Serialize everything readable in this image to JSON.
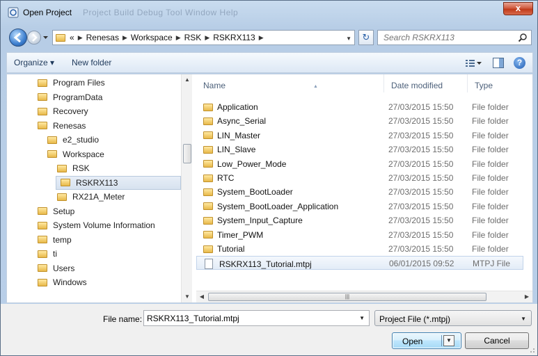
{
  "window": {
    "title": "Open Project",
    "title_ghost": "Project   Build   Debug   Tool   Window   Help",
    "close_label": "x"
  },
  "address": {
    "prefix": "«",
    "crumbs": [
      "Renesas",
      "Workspace",
      "RSK",
      "RSKRX113"
    ],
    "refresh_glyph": "↻"
  },
  "search": {
    "placeholder": "Search RSKRX113"
  },
  "toolbar": {
    "organize": "Organize ▾",
    "new_folder": "New folder",
    "help_glyph": "?"
  },
  "nav_tree": [
    {
      "label": "Program Files",
      "indent": 0
    },
    {
      "label": "ProgramData",
      "indent": 0
    },
    {
      "label": "Recovery",
      "indent": 0
    },
    {
      "label": "Renesas",
      "indent": 0
    },
    {
      "label": "e2_studio",
      "indent": 1
    },
    {
      "label": "Workspace",
      "indent": 1
    },
    {
      "label": "RSK",
      "indent": 2
    },
    {
      "label": "RSKRX113",
      "indent": 3,
      "selected": true
    },
    {
      "label": "RX21A_Meter",
      "indent": 2
    },
    {
      "label": "Setup",
      "indent": 0
    },
    {
      "label": "System Volume Information",
      "indent": 0
    },
    {
      "label": "temp",
      "indent": 0
    },
    {
      "label": "ti",
      "indent": 0
    },
    {
      "label": "Users",
      "indent": 0
    },
    {
      "label": "Windows",
      "indent": 0
    }
  ],
  "columns": {
    "name": "Name",
    "date": "Date modified",
    "type": "Type"
  },
  "files": [
    {
      "name": "Application",
      "date": "27/03/2015 15:50",
      "type": "File folder",
      "kind": "folder"
    },
    {
      "name": "Async_Serial",
      "date": "27/03/2015 15:50",
      "type": "File folder",
      "kind": "folder"
    },
    {
      "name": "LIN_Master",
      "date": "27/03/2015 15:50",
      "type": "File folder",
      "kind": "folder"
    },
    {
      "name": "LIN_Slave",
      "date": "27/03/2015 15:50",
      "type": "File folder",
      "kind": "folder"
    },
    {
      "name": "Low_Power_Mode",
      "date": "27/03/2015 15:50",
      "type": "File folder",
      "kind": "folder"
    },
    {
      "name": "RTC",
      "date": "27/03/2015 15:50",
      "type": "File folder",
      "kind": "folder"
    },
    {
      "name": "System_BootLoader",
      "date": "27/03/2015 15:50",
      "type": "File folder",
      "kind": "folder"
    },
    {
      "name": "System_BootLoader_Application",
      "date": "27/03/2015 15:50",
      "type": "File folder",
      "kind": "folder"
    },
    {
      "name": "System_Input_Capture",
      "date": "27/03/2015 15:50",
      "type": "File folder",
      "kind": "folder"
    },
    {
      "name": "Timer_PWM",
      "date": "27/03/2015 15:50",
      "type": "File folder",
      "kind": "folder"
    },
    {
      "name": "Tutorial",
      "date": "27/03/2015 15:50",
      "type": "File folder",
      "kind": "folder"
    },
    {
      "name": "RSKRX113_Tutorial.mtpj",
      "date": "06/01/2015 09:52",
      "type": "MTPJ File",
      "kind": "file",
      "selected": true
    }
  ],
  "footer": {
    "file_name_label": "File name:",
    "file_name_value": "RSKRX113_Tutorial.mtpj",
    "file_type": "Project File (*.mtpj)",
    "open_label": "Open",
    "cancel_label": "Cancel"
  },
  "icons": {
    "app": "app-icon",
    "back": "back-arrow-icon",
    "forward": "forward-arrow-icon",
    "folder": "folder-icon",
    "search": "search-icon",
    "views": "view-options-icon",
    "preview": "preview-pane-icon",
    "help": "help-icon",
    "file": "document-icon"
  },
  "colors": {
    "accent": "#3c7fb1",
    "frame": "#b9cfe8",
    "selection": "#d7e2ef"
  }
}
